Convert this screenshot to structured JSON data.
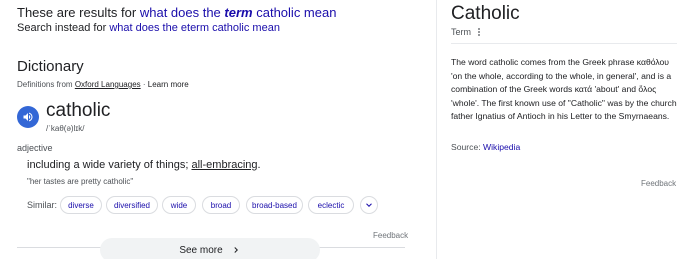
{
  "results_for": {
    "prefix": "These are results for",
    "query_before": "what does the",
    "query_term": "term",
    "query_after": "catholic mean"
  },
  "search_instead": {
    "prefix": "Search instead for",
    "link": "what does the eterm catholic mean"
  },
  "dictionary": {
    "title": "Dictionary",
    "definitions_from_label": "Definitions from",
    "source_name": "Oxford Languages",
    "separator": "·",
    "learn_more": "Learn more",
    "word": "catholic",
    "phonetic": "/ˈkaθ(ə)lɪk/",
    "part_of_speech": "adjective",
    "definition_text": "including a wide variety of things;",
    "definition_link": "all-embracing",
    "definition_end": ".",
    "example": "\"her tastes are pretty catholic\"",
    "similar_label": "Similar:",
    "similar": [
      "diverse",
      "diversified",
      "wide",
      "broad",
      "broad-based",
      "eclectic"
    ],
    "feedback": "Feedback",
    "see_more": "See more"
  },
  "panel": {
    "title": "Catholic",
    "subtitle": "Term",
    "description": "The word catholic comes from the Greek phrase καθόλου 'on the whole, according to the whole, in general', and is a combination of the Greek words κατά 'about' and ὅλος 'whole'. The first known use of \"Catholic\" was by the church father Ignatius of Antioch in his Letter to the Smyrnaeans.",
    "source_label": "Source:",
    "source_link": "Wikipedia",
    "feedback": "Feedback"
  },
  "icons": {
    "speaker": "speaker-icon",
    "more_chips": "chevron-down-icon",
    "see_more": "chevron-right-icon",
    "panel_menu": "more-vert-icon"
  },
  "colors": {
    "link": "#1a0dab",
    "speaker_bg": "#3367d6",
    "see_more_bg": "#f1f3f4"
  }
}
